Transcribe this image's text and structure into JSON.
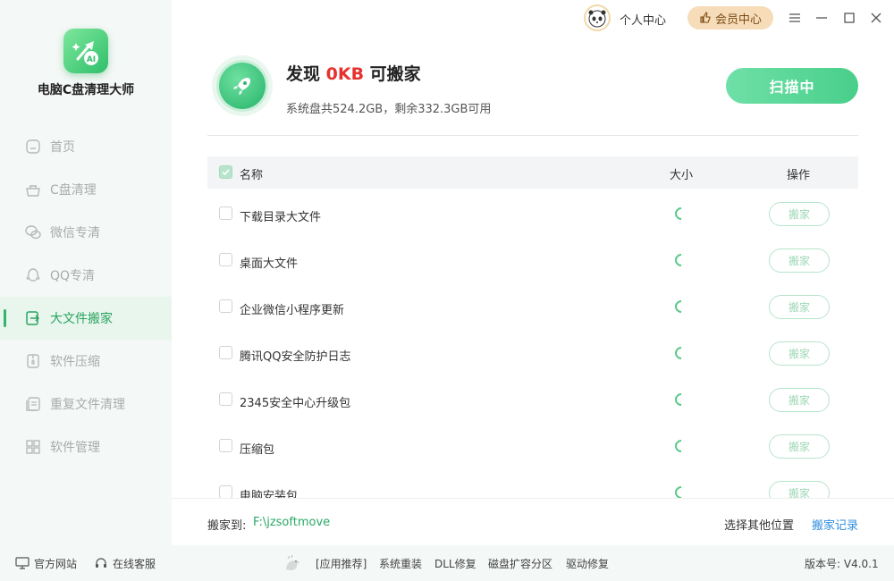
{
  "app": {
    "name": "电脑C盘清理大师"
  },
  "topbar": {
    "personal_center": "个人中心",
    "vip_center": "会员中心"
  },
  "sidebar": {
    "items": [
      {
        "label": "首页",
        "icon": "home-icon"
      },
      {
        "label": "C盘清理",
        "icon": "broom-basket-icon"
      },
      {
        "label": "微信专清",
        "icon": "wechat-icon"
      },
      {
        "label": "QQ专清",
        "icon": "qq-penguin-icon"
      },
      {
        "label": "大文件搬家",
        "icon": "file-move-icon",
        "active": true
      },
      {
        "label": "软件压缩",
        "icon": "compress-icon"
      },
      {
        "label": "重复文件清理",
        "icon": "duplicate-file-icon"
      },
      {
        "label": "软件管理",
        "icon": "apps-grid-icon"
      }
    ]
  },
  "header": {
    "found_prefix": "发现 ",
    "found_size": "0KB",
    "found_suffix": " 可搬家",
    "disk_info": "系统盘共524.2GB，剩余332.3GB可用",
    "scan_button": "扫描中"
  },
  "table": {
    "columns": {
      "name": "名称",
      "size": "大小",
      "action": "操作"
    },
    "action_label": "搬家",
    "rows": [
      {
        "name": "下载目录大文件"
      },
      {
        "name": "桌面大文件"
      },
      {
        "name": "企业微信小程序更新"
      },
      {
        "name": "腾讯QQ安全防护日志"
      },
      {
        "name": "2345安全中心升级包"
      },
      {
        "name": "压缩包"
      },
      {
        "name": "电脑安装包"
      }
    ]
  },
  "footer": {
    "move_to_label": "搬家到:",
    "move_to_path": "F:\\jzsoftmove",
    "choose_other": "选择其他位置",
    "move_records": "搬家记录"
  },
  "bottom_bar": {
    "official_site": "官方网站",
    "online_service": "在线客服",
    "links": [
      "[应用推荐]",
      "系统重装",
      "DLL修复",
      "磁盘扩容分区",
      "驱动修复"
    ],
    "version": "版本号: V4.0.1"
  },
  "colors": {
    "accent": "#33b56b",
    "found_size": "#e5322e",
    "link": "#2f8ee0",
    "vip_bg": "#f6dcb8"
  }
}
